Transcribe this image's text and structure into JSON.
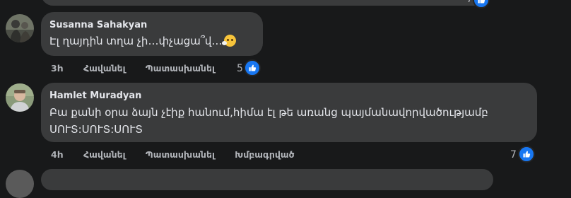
{
  "previous_comment": {
    "actions": "",
    "reaction_count": "7"
  },
  "comments": [
    {
      "author": "Susanna Sahakyan",
      "text": "Էլ ղայդին տղա չի…փչացա՞վ…",
      "emoji_icon": "thinking-face-icon",
      "time": "3h",
      "like_label": "Հավանել",
      "reply_label": "Պատասխանել",
      "edited_label": "",
      "reaction_count": "5"
    },
    {
      "author": "Hamlet Muradyan",
      "text_line1": "Բա քանի օրա ձայն չէիք հանում,հիմա էլ թե առանց պայմանավորվածությամբ",
      "text_line2": "ՍՈՒՏ:ՍՈՒՏ:ՍՈՒՏ",
      "time": "4h",
      "like_label": "Հավանել",
      "reply_label": "Պատասխանել",
      "edited_label": "Խմբագրված",
      "reaction_count": "7"
    }
  ],
  "colors": {
    "background": "#18191a",
    "bubble": "#3a3b3c",
    "text": "#e4e6eb",
    "secondary": "#b0b3b8",
    "like_blue": "#1877f2"
  }
}
